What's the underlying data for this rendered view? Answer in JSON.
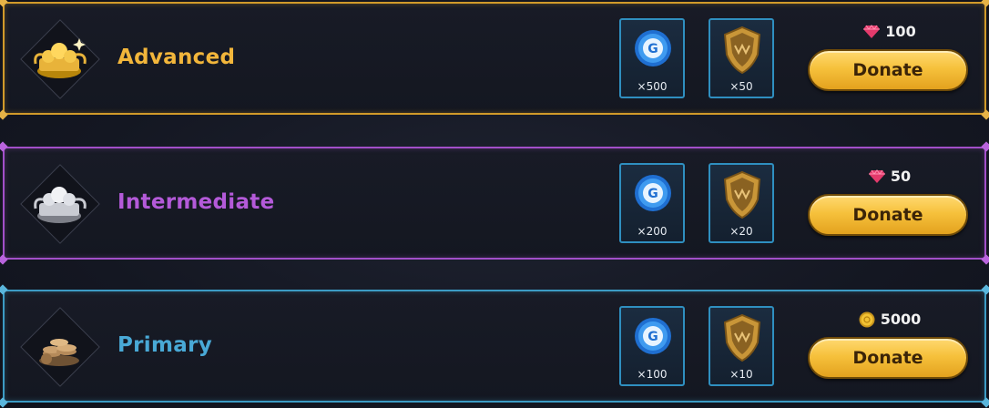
{
  "tiers": [
    {
      "name": "Advanced",
      "cost": {
        "value": "100",
        "icon": "gem-icon",
        "color": "#e33a6b"
      },
      "rewards": [
        {
          "icon": "blue-coin-icon",
          "qty": "×500"
        },
        {
          "icon": "golden-shield-icon",
          "qty": "×50"
        }
      ],
      "button_label": "Donate",
      "accent": "#d19a2a"
    },
    {
      "name": "Intermediate",
      "cost": {
        "value": "50",
        "icon": "gem-icon",
        "color": "#e33a6b"
      },
      "rewards": [
        {
          "icon": "blue-coin-icon",
          "qty": "×200"
        },
        {
          "icon": "golden-shield-icon",
          "qty": "×20"
        }
      ],
      "button_label": "Donate",
      "accent": "#a24fc9"
    },
    {
      "name": "Primary",
      "cost": {
        "value": "5000",
        "icon": "gold-coin-icon",
        "color": "#f2c233"
      },
      "rewards": [
        {
          "icon": "blue-coin-icon",
          "qty": "×100"
        },
        {
          "icon": "golden-shield-icon",
          "qty": "×10"
        }
      ],
      "button_label": "Donate",
      "accent": "#3c9bc4"
    }
  ]
}
